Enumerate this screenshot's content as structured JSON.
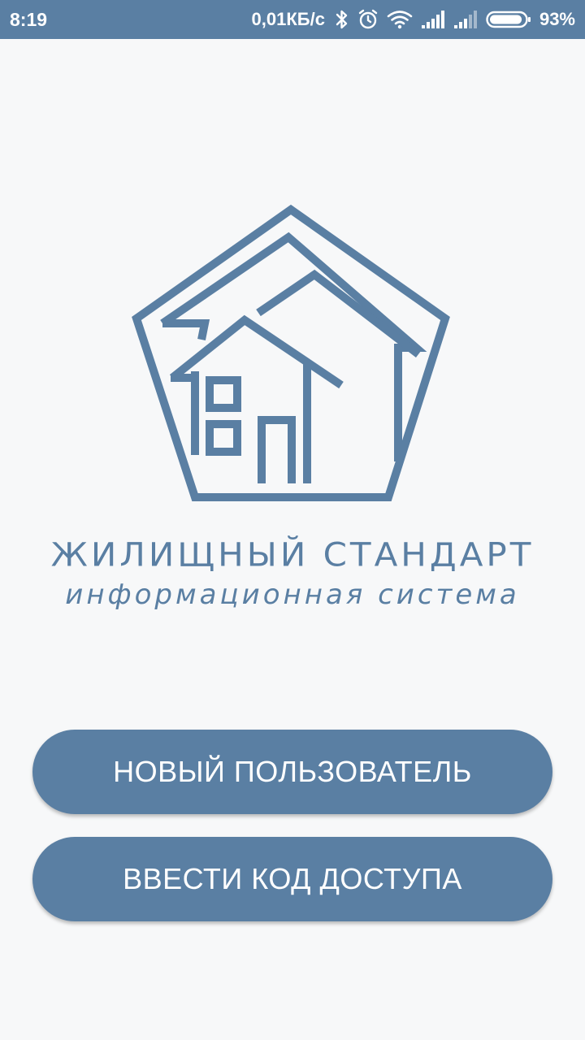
{
  "status_bar": {
    "time": "8:19",
    "network_speed": "0,01КБ/с",
    "battery_percent": "93%",
    "icons": [
      "bluetooth-icon",
      "alarm-icon",
      "wifi-icon",
      "signal-icon",
      "signal-icon-2",
      "battery-icon"
    ],
    "battery_level": 0.93
  },
  "brand": {
    "title": "ЖИЛИЩНЫЙ СТАНДАРТ",
    "subtitle": "информационная система",
    "logo_icon": "house-pentagon-logo"
  },
  "buttons": {
    "new_user": "НОВЫЙ ПОЛЬЗОВАТЕЛЬ",
    "access_code": "ВВЕСТИ КОД ДОСТУПА"
  },
  "colors": {
    "accent": "#5a7fa3",
    "background": "#f7f8f9",
    "text_on_accent": "#ffffff"
  }
}
